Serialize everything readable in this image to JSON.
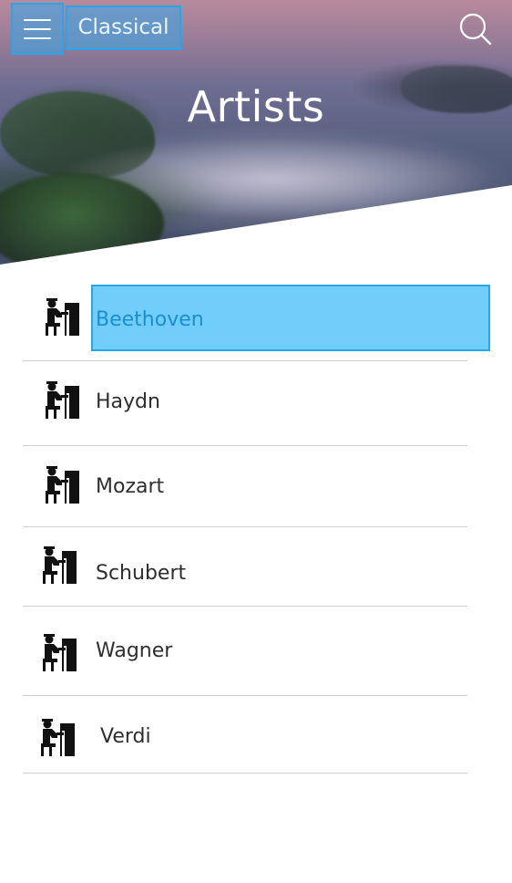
{
  "header": {
    "category": "Classical",
    "title": "Artists",
    "menu_icon": "hamburger-icon",
    "search_icon": "search-icon"
  },
  "colors": {
    "selection_fill": "#71cdfa",
    "selection_border": "#2aa6e8",
    "divider": "#cfcfcf",
    "text": "#2e2e2e"
  },
  "artists": [
    {
      "name": "Beethoven",
      "icon": "pianist-icon",
      "selected": true
    },
    {
      "name": "Haydn",
      "icon": "pianist-icon",
      "selected": false
    },
    {
      "name": "Mozart",
      "icon": "pianist-icon",
      "selected": false
    },
    {
      "name": "Schubert",
      "icon": "pianist-icon",
      "selected": false
    },
    {
      "name": "Wagner",
      "icon": "pianist-icon",
      "selected": false
    },
    {
      "name": "Verdi",
      "icon": "pianist-icon",
      "selected": false
    }
  ]
}
